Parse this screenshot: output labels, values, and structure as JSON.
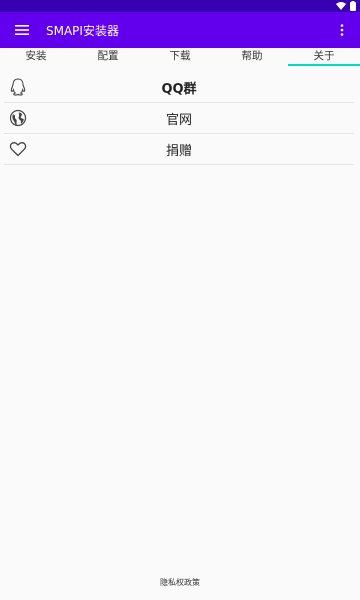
{
  "app": {
    "title": "SMAPI安装器",
    "colors": {
      "primary": "#6200ee",
      "primary_dark": "#3700b3",
      "accent": "#03dac5"
    }
  },
  "tabs": [
    {
      "label": "安装"
    },
    {
      "label": "配置"
    },
    {
      "label": "下载"
    },
    {
      "label": "帮助"
    },
    {
      "label": "关于",
      "active": true
    }
  ],
  "about_items": [
    {
      "label": "QQ群",
      "icon": "qq-icon"
    },
    {
      "label": "官网",
      "icon": "globe-icon"
    },
    {
      "label": "捐赠",
      "icon": "heart-icon"
    }
  ],
  "footer": {
    "privacy_label": "隐私权政策"
  }
}
